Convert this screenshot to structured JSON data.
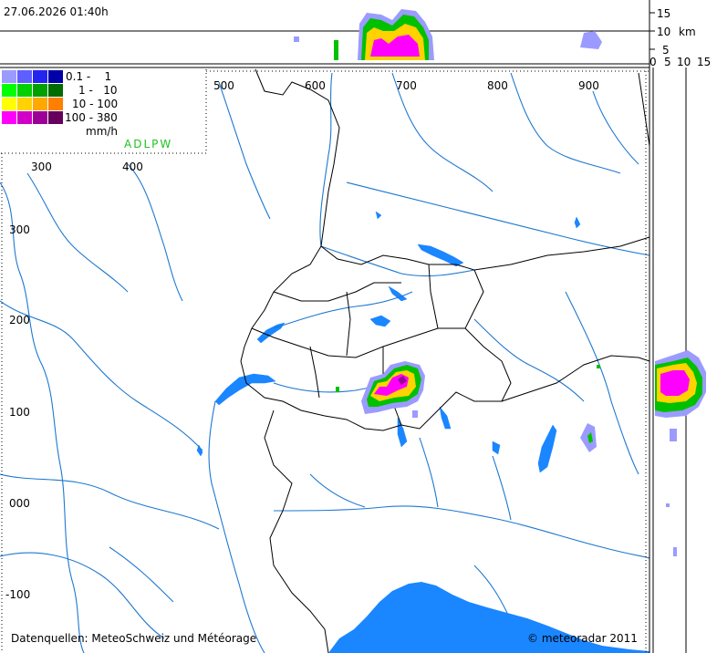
{
  "timestamp": "27.06.2026 01:40h",
  "legend": {
    "ranges": [
      "0.1 -    1",
      "1 -   10",
      "10 - 100",
      "100 - 380"
    ],
    "unit": "mm/h",
    "stations": "ADLPW",
    "colors": [
      [
        "#9b9bff",
        "#5f5fff",
        "#2424f0",
        "#0000a8"
      ],
      [
        "#00ff00",
        "#00d000",
        "#00a000",
        "#006c00"
      ],
      [
        "#ffff00",
        "#ffd200",
        "#ffa800",
        "#ff7f00"
      ],
      [
        "#ff00ff",
        "#d000c8",
        "#9c0096",
        "#66005e"
      ]
    ]
  },
  "top_axis": [
    "500",
    "600",
    "700",
    "800",
    "900"
  ],
  "inner_axis": [
    "300",
    "400"
  ],
  "left_axis": [
    "300",
    "200",
    "100",
    "000",
    "-100"
  ],
  "height_axis": {
    "ticks": [
      "15",
      "10",
      "5"
    ],
    "unit": "km"
  },
  "side_axis": {
    "ticks": [
      "0",
      "5",
      "10",
      "15"
    ]
  },
  "footer": {
    "sources": "Datenquellen: MeteoSchweiz und Météorage",
    "copyright": "© meteoradar 2011"
  },
  "colors": {
    "water": "#1a86ff",
    "river": "#1e78d0",
    "border": "#000000"
  }
}
